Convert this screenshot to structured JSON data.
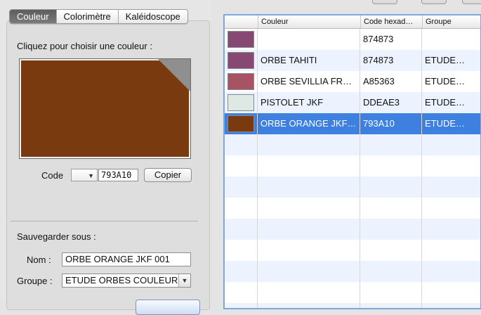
{
  "tabs": [
    {
      "label": "Couleur",
      "active": true
    },
    {
      "label": "Colorimètre",
      "active": false
    },
    {
      "label": "Kaléidoscope",
      "active": false
    }
  ],
  "picker": {
    "prompt": "Cliquez pour choisir une couleur :",
    "current_color": "#793A10"
  },
  "code": {
    "label": "Code",
    "value": "793A10",
    "copy_label": "Copier"
  },
  "save": {
    "title": "Sauvegarder sous :",
    "name_label": "Nom :",
    "name_value": "ORBE ORANGE JKF 001",
    "group_label": "Groupe :",
    "group_value": "ETUDE ORBES COULEUR"
  },
  "table": {
    "headers": [
      "",
      "Couleur",
      "Code hexad…",
      "Groupe"
    ],
    "rows": [
      {
        "swatch": "#874873",
        "name": "",
        "code": "874873",
        "group": ""
      },
      {
        "swatch": "#874873",
        "name": "ORBE TAHITI",
        "code": "874873",
        "group": "ETUDE…"
      },
      {
        "swatch": "#A85363",
        "name": "ORBE SEVILLIA FR…",
        "code": "A85363",
        "group": "ETUDE…"
      },
      {
        "swatch": "#DDEAE3",
        "name": "PISTOLET JKF",
        "code": "DDEAE3",
        "group": "ETUDE…"
      },
      {
        "swatch": "#793A10",
        "name": "ORBE ORANGE JKF…",
        "code": "793A10",
        "group": "ETUDE…",
        "selected": true
      }
    ]
  },
  "colors": {
    "selection": "#3D80DF",
    "alt_row": "#EDF3FE",
    "focus_ring": "#7FA6D8"
  }
}
